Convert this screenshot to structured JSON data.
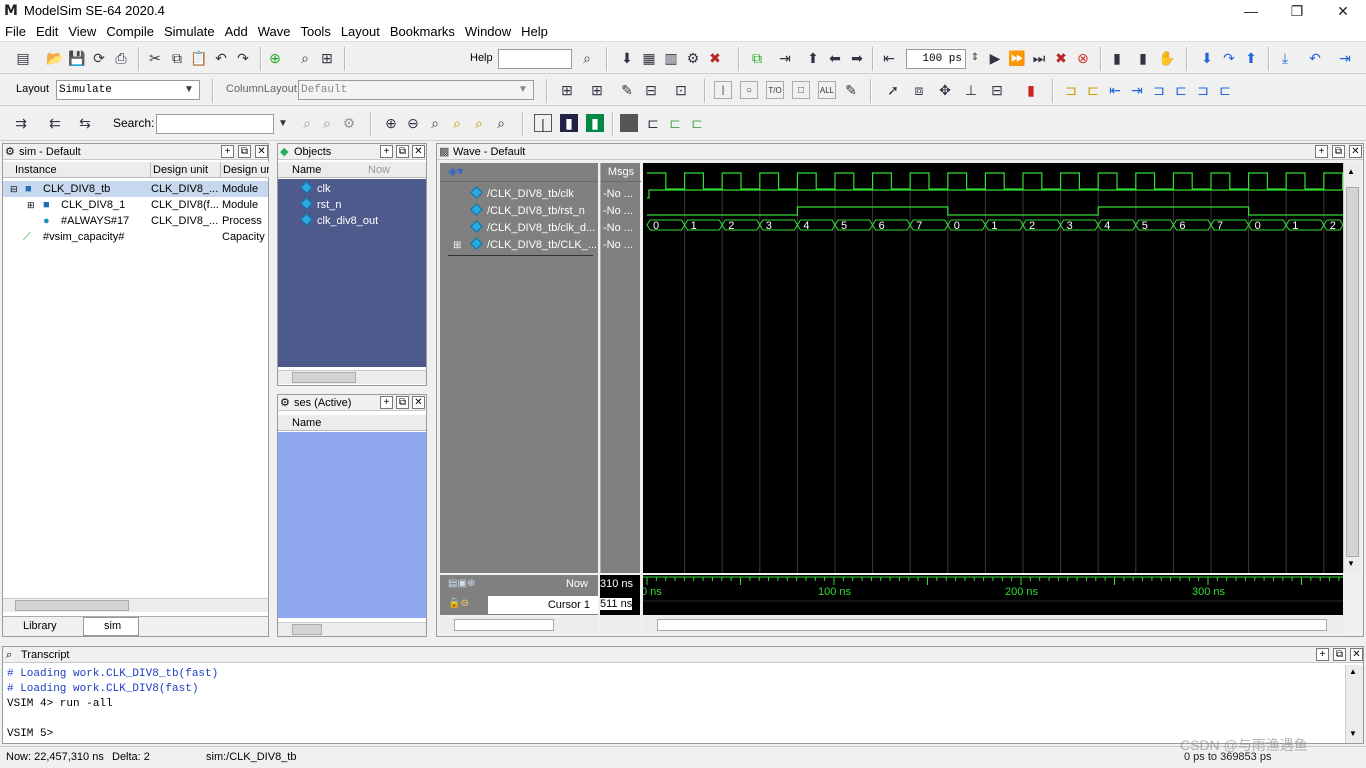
{
  "window": {
    "title": "ModelSim SE-64 2020.4",
    "logo": "M"
  },
  "menu": [
    "File",
    "Edit",
    "View",
    "Compile",
    "Simulate",
    "Add",
    "Wave",
    "Tools",
    "Layout",
    "Bookmarks",
    "Window",
    "Help"
  ],
  "toolbar1": {
    "help_label": "Help",
    "run_length": "100 ps"
  },
  "toolbar2": {
    "layout_label": "Layout",
    "layout_value": "Simulate",
    "column_layout_label": "ColumnLayout",
    "column_layout_value": "Default"
  },
  "toolbar3": {
    "search_label": "Search:"
  },
  "sim_panel": {
    "title": "sim - Default",
    "columns": [
      "Instance",
      "Design unit",
      "Design ur"
    ],
    "rows": [
      {
        "instance": "CLK_DIV8_tb",
        "unit": "CLK_DIV8_...",
        "type": "Module"
      },
      {
        "instance": "CLK_DIV8_1",
        "unit": "CLK_DIV8(f...",
        "type": "Module"
      },
      {
        "instance": "#ALWAYS#17",
        "unit": "CLK_DIV8_...",
        "type": "Process"
      },
      {
        "instance": "#vsim_capacity#",
        "unit": "",
        "type": "Capacity"
      }
    ],
    "tabs": [
      "Library",
      "sim"
    ]
  },
  "objects_panel": {
    "title": "Objects",
    "columns": [
      "Name",
      "Now"
    ],
    "items": [
      "clk",
      "rst_n",
      "clk_div8_out"
    ]
  },
  "processes_panel": {
    "title": "ses (Active)",
    "columns": [
      "Name"
    ]
  },
  "wave_panel": {
    "title": "Wave - Default",
    "msgs_label": "Msgs",
    "signals": [
      {
        "name": "/CLK_DIV8_tb/clk",
        "msg": "-No ..."
      },
      {
        "name": "/CLK_DIV8_tb/rst_n",
        "msg": "-No ..."
      },
      {
        "name": "/CLK_DIV8_tb/clk_d...",
        "msg": "-No ..."
      },
      {
        "name": "/CLK_DIV8_tb/CLK_...",
        "msg": "-No ..."
      }
    ],
    "now_label": "Now",
    "now_value": "310 ns",
    "cursor_label": "Cursor 1",
    "cursor_value": "511 ns",
    "counter_values": [
      "0",
      "1",
      "2",
      "3",
      "4",
      "5",
      "6",
      "7",
      "0",
      "1",
      "2",
      "3",
      "4",
      "5",
      "6",
      "7",
      "0",
      "1",
      "2"
    ],
    "time_labels": [
      "0 ns",
      "100 ns",
      "200 ns",
      "300 ns"
    ],
    "wave_color": "#33dd33"
  },
  "transcript": {
    "title": "Transcript",
    "lines": [
      "# Loading work.CLK_DIV8_tb(fast)",
      "# Loading work.CLK_DIV8(fast)",
      "VSIM 4> run -all"
    ],
    "prompt": "VSIM 5>"
  },
  "statusbar": {
    "now": "Now: 22,457,310 ns",
    "delta": "Delta: 2",
    "context": "sim:/CLK_DIV8_tb",
    "range": "0 ps to 369853 ps",
    "watermark": "CSDN @与雨渔遇鱼"
  }
}
